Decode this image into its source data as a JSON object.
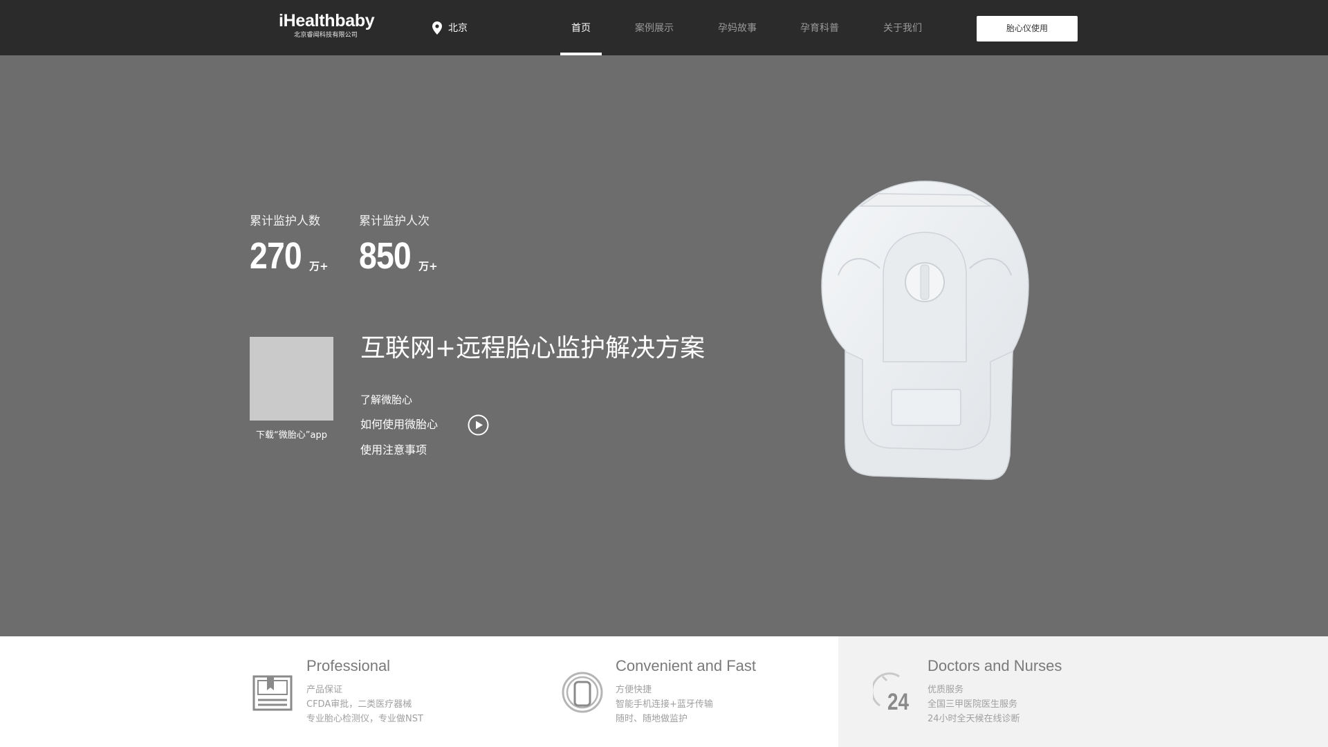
{
  "header": {
    "logo_name": "iHealthbaby",
    "logo_sub": "北京睿闻科技有限公司",
    "location": "北京",
    "nav": [
      {
        "label": "首页",
        "active": true
      },
      {
        "label": "案例展示",
        "active": false
      },
      {
        "label": "孕妈故事",
        "active": false
      },
      {
        "label": "孕育科普",
        "active": false
      },
      {
        "label": "关于我们",
        "active": false
      }
    ],
    "cta_label": "胎心仪使用"
  },
  "hero": {
    "stats": [
      {
        "label": "累计监护人数",
        "value": "270",
        "unit": "万+"
      },
      {
        "label": "累计监护人次",
        "value": "850",
        "unit": "万+"
      }
    ],
    "qr_caption": "下载“微胎心”app",
    "headline": "互联网+远程胎心监护解决方案",
    "links": [
      "了解微胎心",
      "如何使用微胎心",
      "使用注意事项"
    ]
  },
  "features": [
    {
      "title": "Professional",
      "lines": [
        "产品保证",
        "CFDA审批，二类医疗器械",
        "专业胎心检测仪，专业做NST"
      ],
      "icon": "certificate-icon"
    },
    {
      "title": "Convenient and Fast",
      "lines": [
        "方便快捷",
        "智能手机连接+蓝牙传输",
        "随时、随地做监护"
      ],
      "icon": "phone-icon"
    },
    {
      "title": "Doctors and Nurses",
      "lines": [
        "优质服务",
        "全国三甲医院医生服务",
        "24小时全天候在线诊断"
      ],
      "icon": "clock-24-icon",
      "icon_text": "24"
    }
  ],
  "colors": {
    "header_bg": "#2b2b2b",
    "hero_bg": "#6d6d6d",
    "feature_highlight_bg": "#f2f2f2",
    "nav_inactive": "#9a9a9a"
  }
}
